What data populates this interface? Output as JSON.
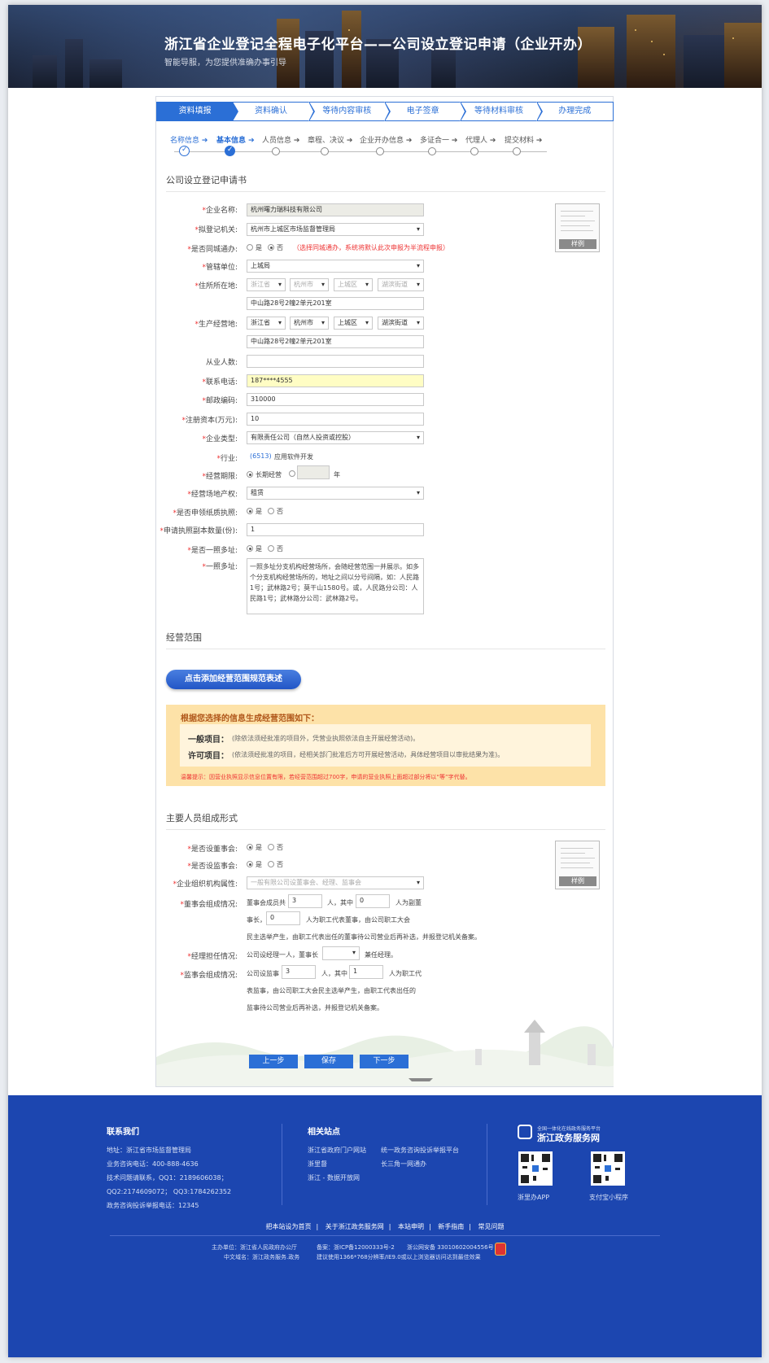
{
  "header": {
    "title": "浙江省企业登记全程电子化平台——公司设立登记申请（企业开办）",
    "subtitle": "智能导服，为您提供准确办事引导"
  },
  "steps": [
    "资料填报",
    "资料确认",
    "等待内容审核",
    "电子签章",
    "等待材料审核",
    "办理完成"
  ],
  "substeps": [
    "名称信息",
    "基本信息",
    "人员信息",
    "章程、决议",
    "企业开办信息",
    "多证合一",
    "代理人",
    "提交材料"
  ],
  "form": {
    "section_title": "公司设立登记申请书",
    "labels": {
      "name": "企业名称:",
      "authority": "拟登记机关:",
      "samecity": "是否同城通办:",
      "jurisdiction": "管辖单位:",
      "address": "住所所在地:",
      "production": "生产经营地:",
      "employees": "从业人数:",
      "phone": "联系电话:",
      "postcode": "邮政编码:",
      "capital": "注册资本(万元):",
      "type": "企业类型:",
      "industry": "行业:",
      "term": "经营期限:",
      "premises": "经营场地产权:",
      "paper": "是否申领纸质执照:",
      "copies": "申请执照副本数量(份):",
      "multi": "是否一照多址:",
      "multiaddr": "一照多址:"
    },
    "values": {
      "name": "杭州曙力瑞科技有限公司",
      "authority": "杭州市上城区市场监督管理局",
      "jurisdiction": "上城局",
      "addr_province": "浙江省",
      "addr_city": "杭州市",
      "addr_district": "上城区",
      "addr_street": "湖滨街道",
      "address_detail": "中山路28号2幢2单元201室",
      "prod_province": "浙江省",
      "prod_city": "杭州市",
      "prod_district": "上城区",
      "prod_street": "湖滨街道",
      "production_detail": "中山路28号2幢2单元201室",
      "employees": "",
      "phone": "187****4555",
      "postcode": "310000",
      "capital": "10",
      "type": "有限责任公司（自然人投资或控股）",
      "industry_code": "(6513)",
      "industry_name": "应用软件开发",
      "term_year_unit": "年",
      "premises": "租赁",
      "copies": "1",
      "multiaddr": "一照多址分支机构经营场所，会随经营范围一并展示。如多个分支机构经营场所的，地址之间以分号间隔，如：人民路1号；武林路2号；莫干山1580号。或，人民路分公司：人民路1号；武林路分公司：武林路2号。"
    },
    "radio": {
      "yes": "是",
      "no": "否",
      "long_term": "长期经营"
    },
    "samecity_note": "（选择同城通办，系统将默认此次申报为半流程申报）",
    "sample_label": "样例"
  },
  "scope": {
    "section_title": "经营范围",
    "add_button": "点击添加经营范围规范表述",
    "header": "根据您选择的信息生成经营范围如下：",
    "general_label": "一般项目：",
    "general_text": "(除依法须经批准的项目外，凭营业执照依法自主开展经营活动)。",
    "license_label": "许可项目：",
    "license_text": "(依法须经批准的项目，经相关部门批准后方可开展经营活动，具体经营项目以审批结果为准)。",
    "tip": "温馨提示：因营业执照显示信息位置有限，若经营范围超过700字，申请的营业执照上面超过部分将以“等”字代替。"
  },
  "personnel": {
    "section_title": "主要人员组成形式",
    "labels": {
      "board": "是否设董事会:",
      "supervisors": "是否设监事会:",
      "org": "企业组织机构属性:",
      "board_comp": "董事会组成情况:",
      "manager": "经理担任情况:",
      "sup_comp": "监事会组成情况:"
    },
    "org_value": "一般有限公司设董事会、经理、监事会",
    "board_t1": "董事会成员共",
    "board_n1": "3",
    "board_t2": "人，其中",
    "board_n2": "0",
    "board_t3": "人为副董",
    "board_t4": "事长，",
    "board_n3": "0",
    "board_t5": "人为职工代表董事，由公司职工大会",
    "board_t6": "民主选举产生，由职工代表出任的董事待公司营业后再补选，并报登记机关备案。",
    "manager_t1": "公司设经理一人，董事长",
    "manager_t2": "兼任经理。",
    "sup_t1": "公司设监事",
    "sup_n1": "3",
    "sup_t2": "人，其中",
    "sup_n2": "1",
    "sup_t3": "人为职工代",
    "sup_t4": "表监事，由公司职工大会民主选举产生，由职工代表出任的",
    "sup_t5": "监事待公司营业后再补选，并报登记机关备案。"
  },
  "buttons": {
    "prev": "上一步",
    "save": "保存",
    "next": "下一步"
  },
  "footer": {
    "contact_title": "联系我们",
    "contact": [
      "地址：浙江省市场监督管理局",
      "业务咨询电话：400-888-4636",
      "技术问题请联系，QQ1：2189606038；",
      "QQ2:2174609072；  QQ3:1784262352",
      "政务咨询投诉举报电话：12345"
    ],
    "sites_title": "相关站点",
    "sites_col1": [
      "浙江省政府门户网站",
      "浙里督",
      "浙江 - 数据开放网"
    ],
    "sites_col2": [
      "统一政务咨询投诉举报平台",
      "长三角一网通办"
    ],
    "brand_small": "全国一体化在线政务服务平台",
    "brand": "浙江政务服务网",
    "qr1": "浙里办APP",
    "qr2": "支付宝小程序",
    "links": [
      "把本站设为首页",
      "关于浙江政务服务网",
      "本站申明",
      "新手指南",
      "常见问题"
    ],
    "host": "主办单位：浙江省人民政府办公厅",
    "icp": "备案：浙ICP备12000333号-2",
    "police": "浙公网安备 33010602004556号",
    "domain": "中文域名：浙江政务服务.政务",
    "browser": "建议使用1366*768分辨率/IE9.0或以上浏览器访问达到最佳效果"
  }
}
